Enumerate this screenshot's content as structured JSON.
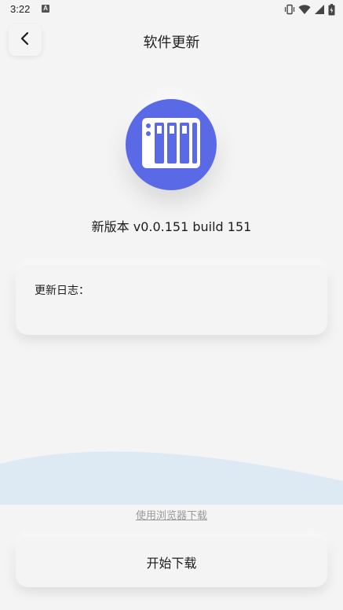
{
  "status_bar": {
    "time": "3:22",
    "notification_icon": "a-icon",
    "icons": [
      "vibrate-icon",
      "wifi-icon",
      "signal-icon",
      "battery-icon"
    ]
  },
  "header": {
    "title": "软件更新",
    "back_icon": "chevron-left-icon"
  },
  "app": {
    "icon": "server-rack-icon",
    "icon_color": "#5a6ae6",
    "version_text": "新版本 v0.0.151 build 151"
  },
  "changelog": {
    "label": "更新日志："
  },
  "footer": {
    "browser_link": "使用浏览器下载",
    "download_button": "开始下载",
    "wave_color": "#dde9f3"
  }
}
